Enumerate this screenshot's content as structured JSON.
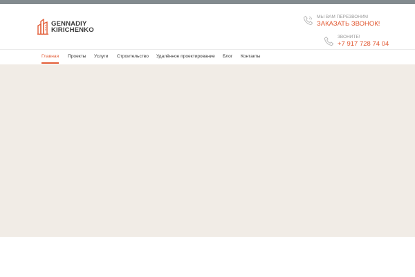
{
  "logo": {
    "line1": "GENNADIY",
    "line2": "KIRICHENKO"
  },
  "callback": {
    "small": "МЫ ВАМ ПЕРЕЗВОНИМ",
    "big": "ЗАКАЗАТЬ ЗВОНОК!"
  },
  "phone": {
    "small": "ЗВОНИТЕ!",
    "number": "+7 917 728 74 04"
  },
  "nav": {
    "items": [
      {
        "label": "Главная",
        "active": true
      },
      {
        "label": "Проекты"
      },
      {
        "label": "Услуги"
      },
      {
        "label": "Строительство"
      },
      {
        "label": "Удалённое проектирование"
      },
      {
        "label": "Блог"
      },
      {
        "label": "Контакты"
      }
    ]
  },
  "colors": {
    "accent": "#e25b35",
    "topbar": "#838b8f",
    "hero": "#f1ece6"
  },
  "icons": {
    "logo": "building-logo-icon",
    "callback": "phone-callback-icon",
    "phone": "phone-icon"
  }
}
